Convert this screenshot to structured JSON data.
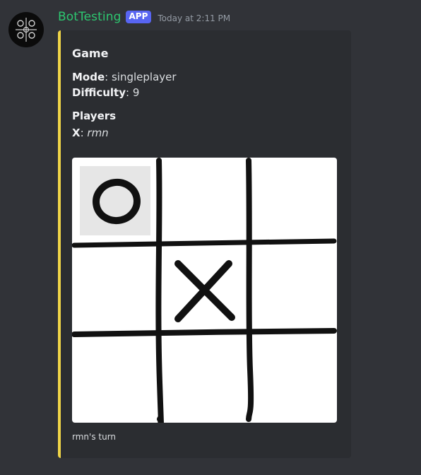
{
  "message": {
    "username": "BotTesting",
    "badge": "APP",
    "timestamp": "Today at 2:11 PM",
    "avatar_icon": "bot-avatar-icon"
  },
  "embed": {
    "accent_color": "#f0d548",
    "title": "Game",
    "fields": {
      "mode_label": "Mode",
      "mode_value": "singleplayer",
      "difficulty_label": "Difficulty",
      "difficulty_value": "9",
      "players_heading": "Players",
      "player_x_label": "X",
      "player_x_value": "rmn"
    },
    "board": {
      "cells": [
        "O",
        "",
        "",
        "",
        "X",
        "",
        "",
        "",
        ""
      ],
      "highlighted_cell": 0
    },
    "footer": "rmn's turn"
  },
  "colors": {
    "background": "#313338",
    "embed_background": "#2b2d31",
    "username": "#2dc770",
    "badge": "#5865f2"
  }
}
